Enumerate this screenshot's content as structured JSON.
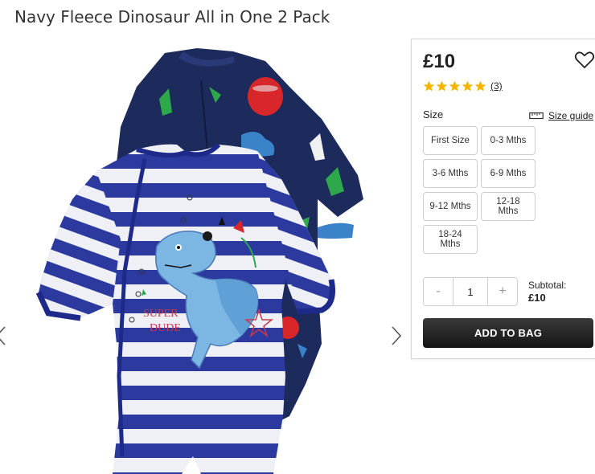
{
  "product": {
    "title": "Navy Fleece Dinosaur All in One 2 Pack"
  },
  "gallery": {
    "image_icon": "product-photo",
    "prev_icon": "chevron-left-icon",
    "next_icon": "chevron-right-icon",
    "embroidery_text": [
      "SUPER",
      "DUDE"
    ]
  },
  "purchase": {
    "price": "£10",
    "wishlist_icon": "heart-icon",
    "rating": {
      "stars": 5,
      "max": 5,
      "count_text": "(3)",
      "star_color": "#f5b400"
    },
    "size_label": "Size",
    "size_guide": {
      "icon": "ruler-icon",
      "label": "Size guide"
    },
    "sizes": [
      "First Size",
      "0-3 Mths",
      "3-6 Mths",
      "6-9 Mths",
      "9-12 Mths",
      "12-18 Mths",
      "18-24 Mths"
    ],
    "quantity": {
      "minus": "-",
      "value": "1",
      "plus": "+"
    },
    "subtotal_label": "Subtotal:",
    "subtotal_value": "£10",
    "add_to_bag": "ADD TO BAG"
  }
}
